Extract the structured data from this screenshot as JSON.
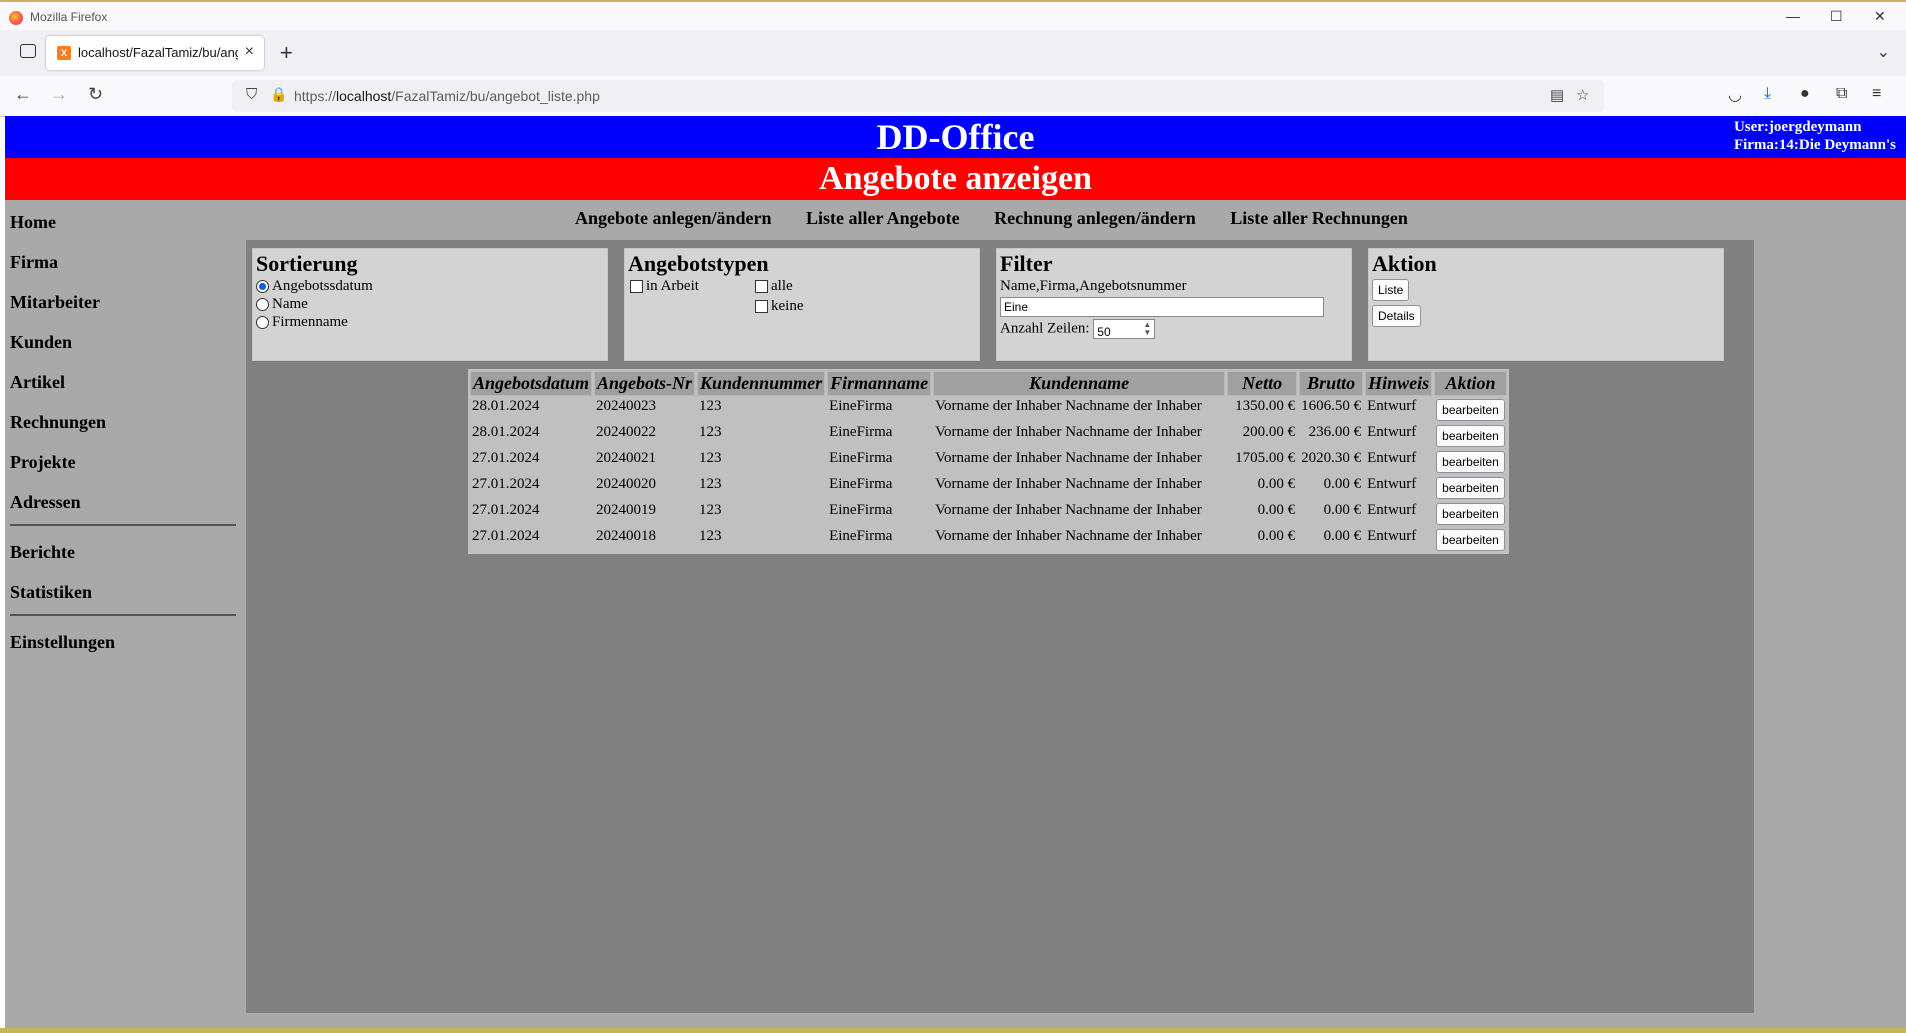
{
  "browser": {
    "window_title": "Mozilla Firefox",
    "tab_title": "localhost/FazalTamiz/bu/angebot_liste.php",
    "url_prefix": "https://",
    "url_host": "localhost",
    "url_path": "/FazalTamiz/bu/angebot_liste.php"
  },
  "header": {
    "app_title": "DD-Office",
    "user_line": "User:joergdeymann",
    "firma_line": "Firma:14:Die Deymann's",
    "page_title": "Angebote anzeigen"
  },
  "sidebar": {
    "items": [
      "Home",
      "Firma",
      "Mitarbeiter",
      "Kunden",
      "Artikel",
      "Rechnungen",
      "Projekte",
      "Adressen"
    ],
    "items2": [
      "Berichte",
      "Statistiken"
    ],
    "items3": [
      "Einstellungen"
    ]
  },
  "topnav": [
    "Angebote anlegen/ändern",
    "Liste aller Angebote",
    "Rechnung anlegen/ändern",
    "Liste aller Rechnungen"
  ],
  "sortierung": {
    "title": "Sortierung",
    "options": [
      "Angebotssdatum",
      "Name",
      "Firmenname"
    ],
    "selected": "Angebotssdatum"
  },
  "angebotstypen": {
    "title": "Angebotstypen",
    "in_arbeit": "in Arbeit",
    "alle": "alle",
    "keine": "keine"
  },
  "filter": {
    "title": "Filter",
    "label": "Name,Firma,Angebotsnummer",
    "value": "Eine",
    "rows_label": "Anzahl Zeilen:",
    "rows_value": "50"
  },
  "aktion": {
    "title": "Aktion",
    "liste": "Liste",
    "details": "Details"
  },
  "table": {
    "headers": [
      "Angebotsdatum",
      "Angebots-Nr",
      "Kundennummer",
      "Firmanname",
      "Kundenname",
      "Netto",
      "Brutto",
      "Hinweis",
      "Aktion"
    ],
    "button_label": "bearbeiten",
    "rows": [
      [
        "28.01.2024",
        "20240023",
        "123",
        "EineFirma",
        "Vorname der Inhaber Nachname der Inhaber",
        "1350.00 €",
        "1606.50 €",
        "Entwurf"
      ],
      [
        "28.01.2024",
        "20240022",
        "123",
        "EineFirma",
        "Vorname der Inhaber Nachname der Inhaber",
        "200.00 €",
        "236.00 €",
        "Entwurf"
      ],
      [
        "27.01.2024",
        "20240021",
        "123",
        "EineFirma",
        "Vorname der Inhaber Nachname der Inhaber",
        "1705.00 €",
        "2020.30 €",
        "Entwurf"
      ],
      [
        "27.01.2024",
        "20240020",
        "123",
        "EineFirma",
        "Vorname der Inhaber Nachname der Inhaber",
        "0.00 €",
        "0.00 €",
        "Entwurf"
      ],
      [
        "27.01.2024",
        "20240019",
        "123",
        "EineFirma",
        "Vorname der Inhaber Nachname der Inhaber",
        "0.00 €",
        "0.00 €",
        "Entwurf"
      ],
      [
        "27.01.2024",
        "20240018",
        "123",
        "EineFirma",
        "Vorname der Inhaber Nachname der Inhaber",
        "0.00 €",
        "0.00 €",
        "Entwurf"
      ]
    ]
  }
}
